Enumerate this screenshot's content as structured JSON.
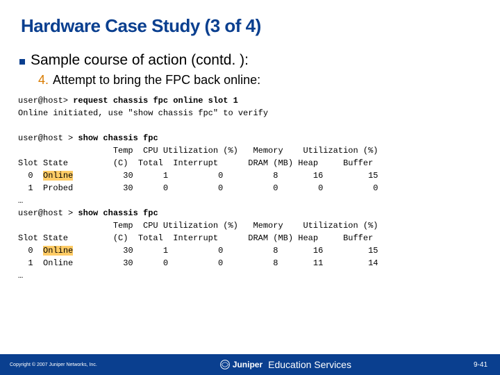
{
  "title": "Hardware Case Study (3 of 4)",
  "bullet": "Sample course of action (contd. ):",
  "step_num": "4.",
  "step_text": "Attempt to bring the FPC back online:",
  "term": {
    "cmd1_prompt": "user@host> ",
    "cmd1": "request chassis fpc online slot 1",
    "resp1": "Online initiated, use \"show chassis fpc\" to verify",
    "cmd2_prompt": "user@host > ",
    "cmd2": "show chassis fpc",
    "hdr1": "                   Temp  CPU Utilization (%)   Memory    Utilization (%)",
    "hdr2": "Slot State         (C)  Total  Interrupt      DRAM (MB) Heap     Buffer",
    "r1a": "  0  ",
    "r1a_hl": "Online",
    "r1a_rest": "          30      1          0          8       16         15",
    "r1b": "  1  Probed          30      0          0          0        0          0",
    "ell": "…",
    "cmd3_prompt": "user@host > ",
    "cmd3": "show chassis fpc",
    "hdr3": "                   Temp  CPU Utilization (%)   Memory    Utilization (%)",
    "hdr4": "Slot State         (C)  Total  Interrupt      DRAM (MB) Heap     Buffer",
    "r2a": "  0  ",
    "r2a_hl": "Online",
    "r2a_rest": "          30      1          0          8       16         15",
    "r2b": "  1  Online          30      0          0          8       11         14"
  },
  "footer": {
    "copyright": "Copyright © 2007 Juniper Networks, Inc.",
    "brand": "Juniper",
    "edu": "Education Services",
    "page": "9-41"
  }
}
